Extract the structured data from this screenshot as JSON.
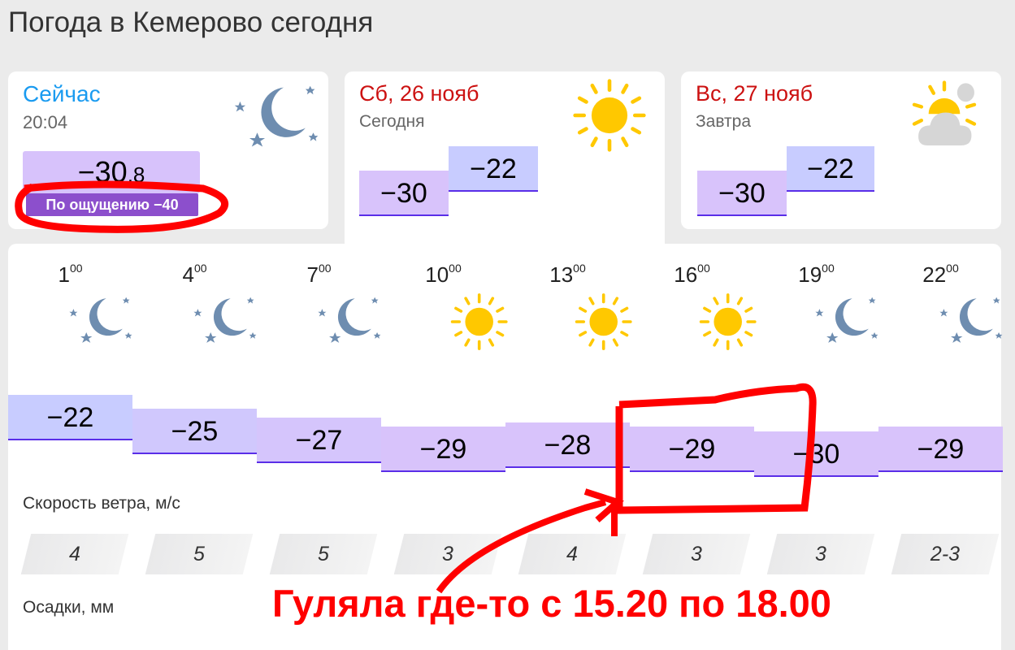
{
  "title": "Погода в Кемерово сегодня",
  "now": {
    "label": "Сейчас",
    "time": "20:04",
    "temp_int": "−30",
    "temp_dec": ",8",
    "feels_like": "По ощущению −40",
    "icon": "moon-stars-icon"
  },
  "days": [
    {
      "label": "Сб, 26 нояб",
      "sub": "Сегодня",
      "night": "−30",
      "day": "−22",
      "icon": "sun-icon"
    },
    {
      "label": "Вс, 27 нояб",
      "sub": "Завтра",
      "night": "−30",
      "day": "−22",
      "icon": "partly-cloudy-icon"
    }
  ],
  "hourly": [
    {
      "hour": "1",
      "min": "00",
      "icon": "moon-stars-icon",
      "temp": -22,
      "temp_label": "−22",
      "wind": "4"
    },
    {
      "hour": "4",
      "min": "00",
      "icon": "moon-stars-icon",
      "temp": -25,
      "temp_label": "−25",
      "wind": "5"
    },
    {
      "hour": "7",
      "min": "00",
      "icon": "moon-stars-icon",
      "temp": -27,
      "temp_label": "−27",
      "wind": "5"
    },
    {
      "hour": "10",
      "min": "00",
      "icon": "sun-icon",
      "temp": -29,
      "temp_label": "−29",
      "wind": "3"
    },
    {
      "hour": "13",
      "min": "00",
      "icon": "sun-icon",
      "temp": -28,
      "temp_label": "−28",
      "wind": "4"
    },
    {
      "hour": "16",
      "min": "00",
      "icon": "sun-icon",
      "temp": -29,
      "temp_label": "−29",
      "wind": "3"
    },
    {
      "hour": "19",
      "min": "00",
      "icon": "moon-stars-icon",
      "temp": -30,
      "temp_label": "−30",
      "wind": "3"
    },
    {
      "hour": "22",
      "min": "00",
      "icon": "moon-stars-icon",
      "temp": -29,
      "temp_label": "−29",
      "wind": "2-3"
    }
  ],
  "wind_label": "Скорость ветра, м/с",
  "precip_label": "Осадки, мм",
  "annotation": {
    "text": "Гуляла где-то с 15.20 по 18.00",
    "color": "#ff0000"
  },
  "colors": {
    "now_label": "#1a9bf0",
    "day_label": "#cc1111",
    "feels_bg": "#8c4fcc",
    "warm_block": "#c8ccff",
    "cold_block": "#d8c3fb",
    "line": "#5a2ee8"
  }
}
